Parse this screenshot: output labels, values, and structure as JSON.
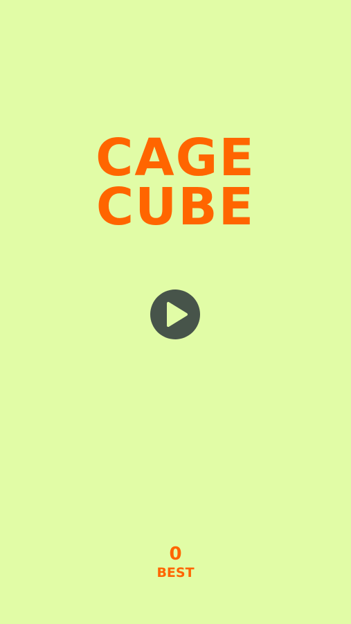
{
  "game": {
    "title_line_1": "CAGE",
    "title_line_2": "CUBE",
    "play_icon": "play-icon",
    "best_score": "0",
    "best_label": "BEST"
  },
  "colors": {
    "background": "#e1fca6",
    "accent": "#ff6500",
    "button": "#47544a",
    "button_icon": "#e1fca6"
  }
}
